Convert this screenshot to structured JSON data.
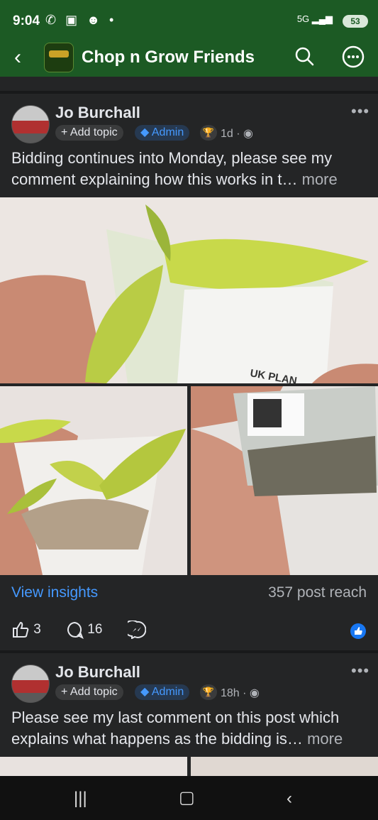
{
  "status_bar": {
    "time": "9:04",
    "network": "5G",
    "battery": "53"
  },
  "app_bar": {
    "title": "Chop n Grow Friends"
  },
  "posts": [
    {
      "author": "Jo Burchall",
      "add_topic": "+ Add topic",
      "admin": "Admin",
      "time": "1d ·",
      "body": "Bidding continues into Monday, please see my comment explaining how this works in t…",
      "more": "more",
      "photo_label": "UK PLAN",
      "insights": "View insights",
      "reach": "357 post reach",
      "likes": "3",
      "comments": "16"
    },
    {
      "author": "Jo Burchall",
      "add_topic": "+ Add topic",
      "admin": "Admin",
      "time": "18h ·",
      "body": "Please see my last comment on this post which explains what happens as the bidding is…",
      "more": "more"
    }
  ],
  "colors": {
    "header": "#1c5a24",
    "link": "#4599ff",
    "background": "#242526"
  }
}
